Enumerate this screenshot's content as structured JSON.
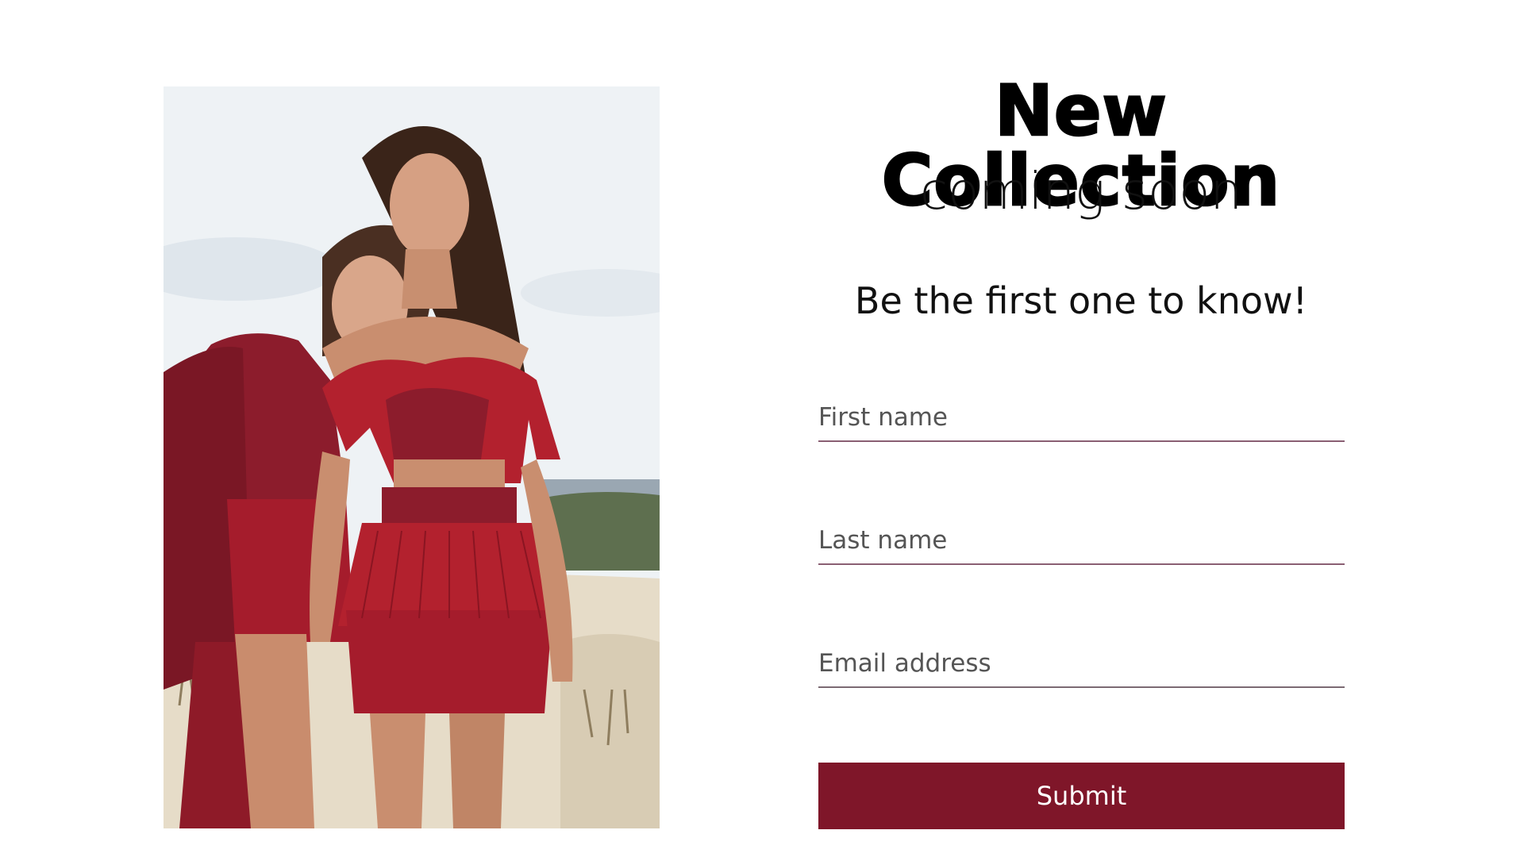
{
  "header": {
    "title": "New Collection",
    "subtitle": "coming soon"
  },
  "tagline": "Be the first one to know!",
  "form": {
    "first_name_placeholder": "First name",
    "last_name_placeholder": "Last name",
    "email_placeholder": "Email address",
    "submit_label": "Submit"
  },
  "colors": {
    "accent": "#7f1629",
    "field_underline": "#8a5f73",
    "dress_red": "#a51c2c"
  },
  "image": {
    "subject": "two-models-in-red-dresses-photo"
  }
}
